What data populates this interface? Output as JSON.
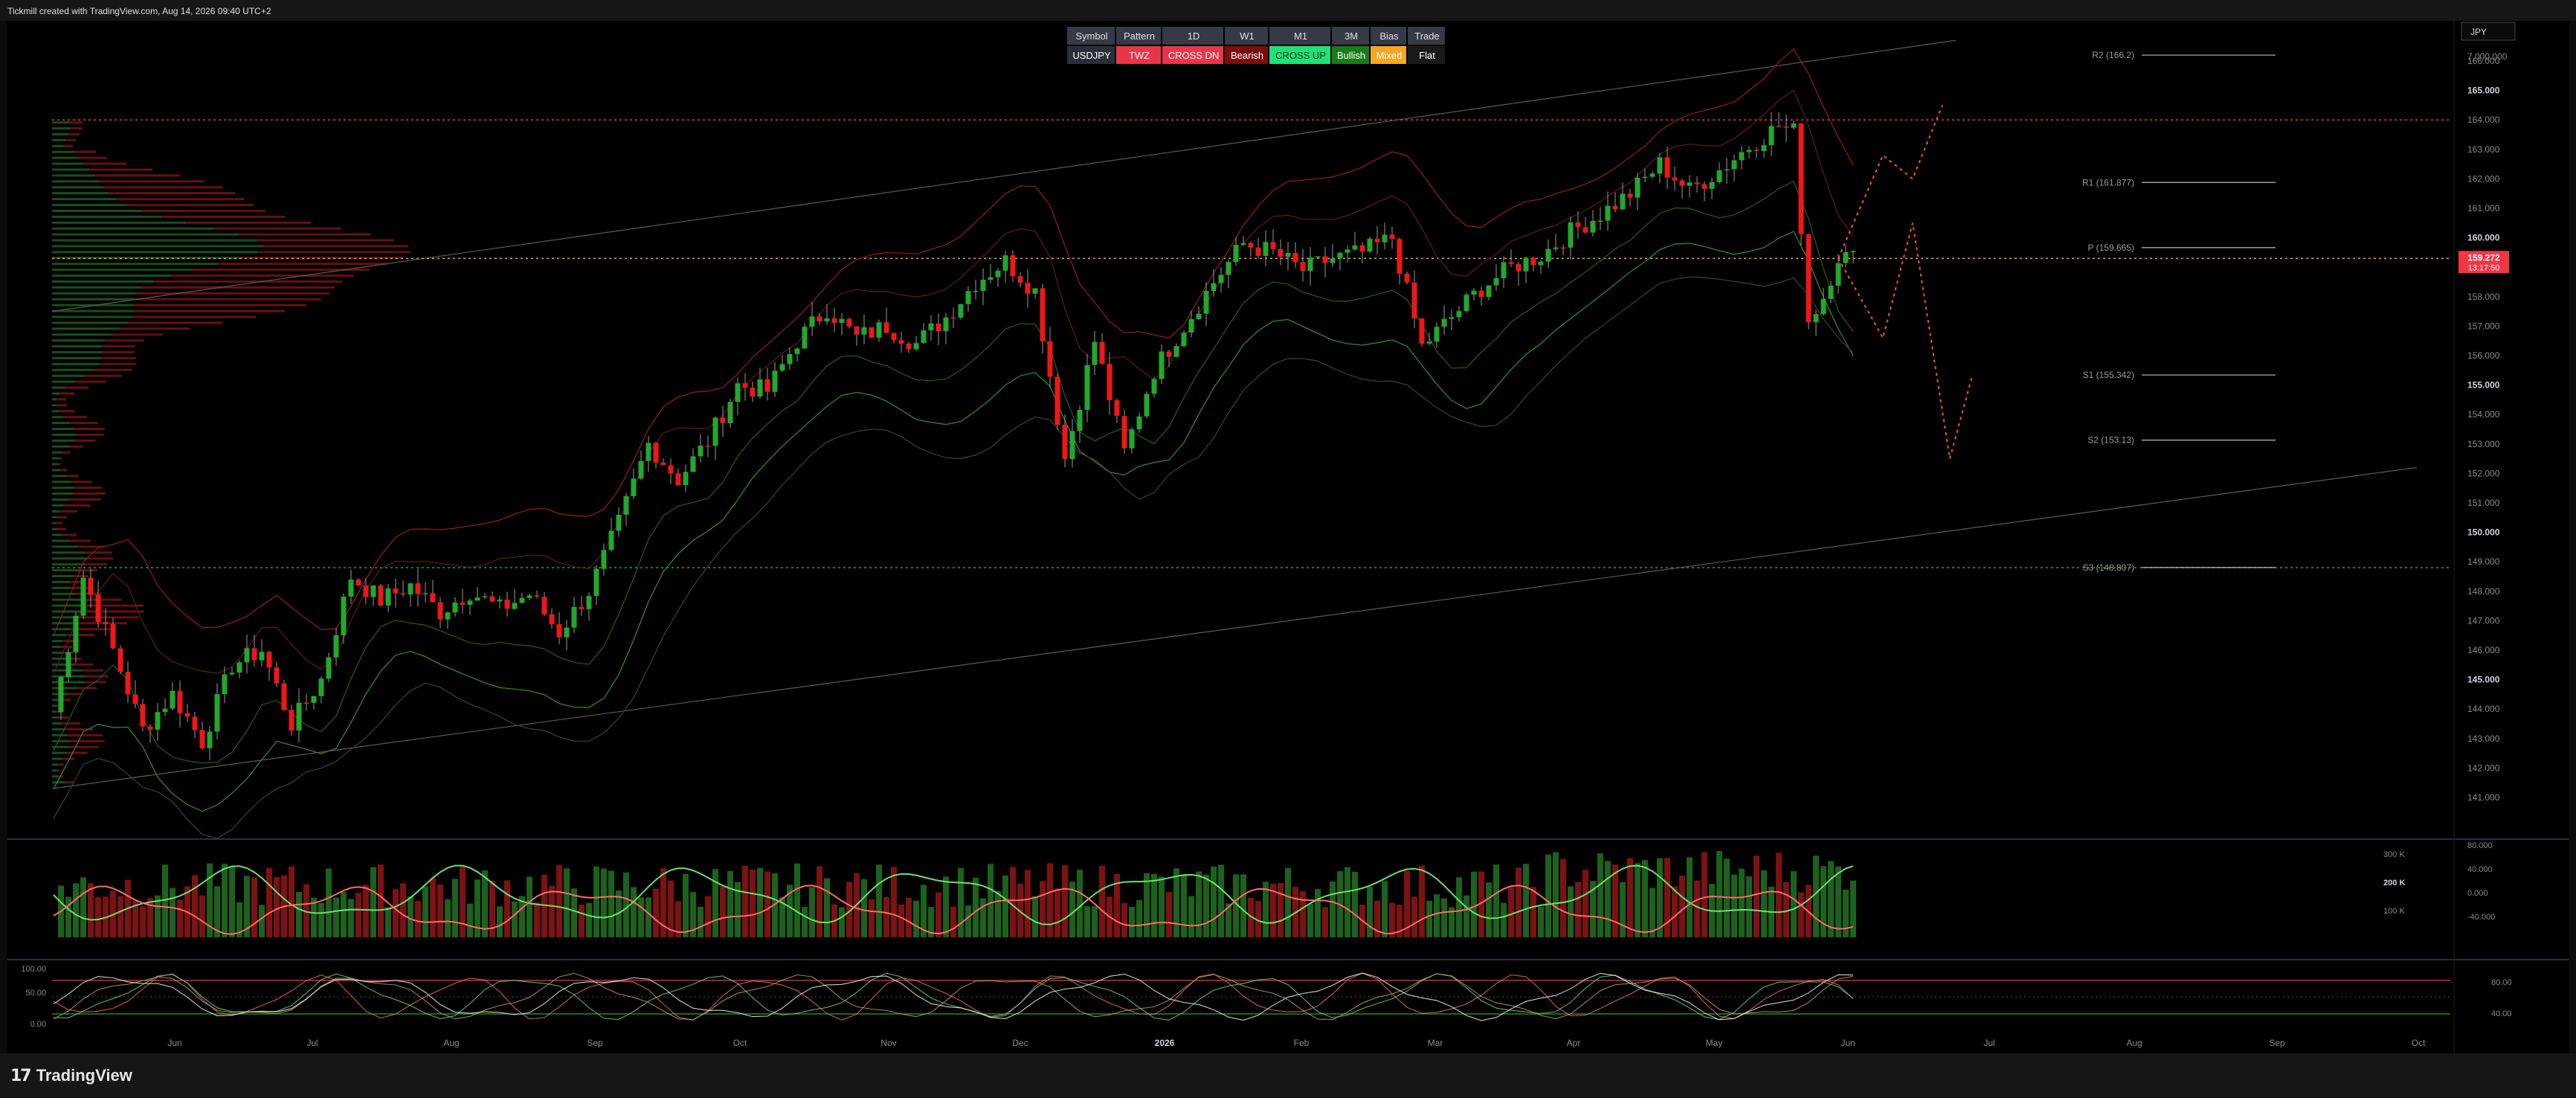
{
  "header": {
    "caption": "Tickmill created with TradingView.com, Aug 14, 2026 09:40 UTC+2"
  },
  "footer": {
    "brand": "TradingView",
    "brand_icon": "tradingview-logo-icon"
  },
  "currency_box": "JPY",
  "table": {
    "headers": [
      "Symbol",
      "Pattern",
      "1D",
      "W1",
      "M1",
      "3M",
      "Bias",
      "Trade"
    ],
    "values": [
      "USDJPY",
      "TWZ",
      "CROSS DN",
      "Bearish",
      "CROSS UP",
      "Bullish",
      "Mixed",
      "Flat"
    ],
    "value_colors": [
      "#2a2e39",
      "#e8354a",
      "#e8354a",
      "#7a0d0d",
      "#1fe07b",
      "#1b7a1b",
      "#f5a623",
      "#1a1a1a"
    ]
  },
  "colors": {
    "up": "#22a82b",
    "down": "#f01616",
    "price_tag": "#f23645",
    "bg": "#000000"
  },
  "price_axis": {
    "labels": [
      "7,000.000",
      "166.000",
      "165.000",
      "164.000",
      "163.000",
      "162.000",
      "161.000",
      "160.000",
      "158.000",
      "157.000",
      "156.000",
      "155.000",
      "154.000",
      "153.000",
      "152.000",
      "151.000",
      "150.000",
      "149.000",
      "148.000",
      "147.000",
      "146.000",
      "145.000",
      "144.000",
      "143.000",
      "142.000",
      "141.000"
    ],
    "last_price": "159.272",
    "countdown": "13:17:50"
  },
  "volume_axis": [
    "300 K",
    "200 K",
    "100 K"
  ],
  "osc_axis": [
    "80.000",
    "40.000",
    "0.000",
    "-40.000"
  ],
  "stoch_axis_left": [
    "100.00",
    "50.00",
    "0.00"
  ],
  "stoch_axis_right": [
    "80.00",
    "40.00"
  ],
  "pivots": [
    "R2 (166.2)",
    "R1 (161.877)",
    "P (159.665)",
    "S1 (155.342)",
    "S2 (153.13)",
    "S3 (148.807)"
  ],
  "chart_data": {
    "type": "candlestick",
    "symbol": "USDJPY",
    "x_ticks": [
      "Jun",
      "Jul",
      "Aug",
      "Sep",
      "Oct",
      "Nov",
      "Dec",
      "2026",
      "Feb",
      "Mar",
      "Apr",
      "May",
      "Jun",
      "Jul",
      "Aug",
      "Sep",
      "Oct"
    ],
    "ylim": [
      140.5,
      166.5
    ],
    "close_path": [
      [
        0,
        143.9
      ],
      [
        4,
        148.5
      ],
      [
        8,
        146.0
      ],
      [
        12,
        143.3
      ],
      [
        16,
        144.5
      ],
      [
        20,
        142.9
      ],
      [
        24,
        145.5
      ],
      [
        28,
        146.0
      ],
      [
        32,
        143.5
      ],
      [
        36,
        145.0
      ],
      [
        40,
        148.5
      ],
      [
        44,
        147.7
      ],
      [
        48,
        148.2
      ],
      [
        52,
        147.3
      ],
      [
        56,
        148.0
      ],
      [
        60,
        147.4
      ],
      [
        64,
        147.9
      ],
      [
        68,
        146.6
      ],
      [
        72,
        148.0
      ],
      [
        76,
        150.3
      ],
      [
        80,
        153.0
      ],
      [
        84,
        151.8
      ],
      [
        88,
        153.1
      ],
      [
        92,
        155.0
      ],
      [
        96,
        154.8
      ],
      [
        100,
        156.5
      ],
      [
        104,
        157.6
      ],
      [
        108,
        156.6
      ],
      [
        112,
        157.0
      ],
      [
        116,
        156.4
      ],
      [
        120,
        157.3
      ],
      [
        124,
        158.5
      ],
      [
        128,
        159.2
      ],
      [
        132,
        158.2
      ],
      [
        136,
        152.5
      ],
      [
        140,
        156.5
      ],
      [
        144,
        152.7
      ],
      [
        148,
        155.5
      ],
      [
        152,
        157.0
      ],
      [
        156,
        158.5
      ],
      [
        160,
        159.8
      ],
      [
        164,
        159.5
      ],
      [
        168,
        158.9
      ],
      [
        172,
        159.3
      ],
      [
        176,
        159.5
      ],
      [
        180,
        160.0
      ],
      [
        184,
        156.3
      ],
      [
        188,
        157.3
      ],
      [
        192,
        158.3
      ],
      [
        196,
        159.0
      ],
      [
        200,
        159.4
      ],
      [
        204,
        160.2
      ],
      [
        208,
        160.8
      ],
      [
        212,
        161.5
      ],
      [
        216,
        162.5
      ],
      [
        220,
        161.6
      ],
      [
        224,
        162.3
      ],
      [
        228,
        163.1
      ],
      [
        232,
        163.8
      ],
      [
        234,
        163.6
      ],
      [
        236,
        157.2
      ],
      [
        238,
        158.0
      ],
      [
        240,
        159.4
      ],
      [
        242,
        159.3
      ]
    ],
    "volume_profile_poc": 159.3,
    "horizontal_levels": [
      164.0,
      159.3,
      148.8
    ],
    "forecast_path": [
      [
        240,
        159.3
      ],
      [
        246,
        156.6
      ],
      [
        250,
        160.5
      ],
      [
        255,
        152.5
      ],
      [
        258,
        155.3
      ]
    ],
    "forecast_alt_path": [
      [
        240,
        159.3
      ],
      [
        246,
        162.8
      ],
      [
        250,
        162.0
      ],
      [
        254,
        164.5
      ]
    ]
  }
}
